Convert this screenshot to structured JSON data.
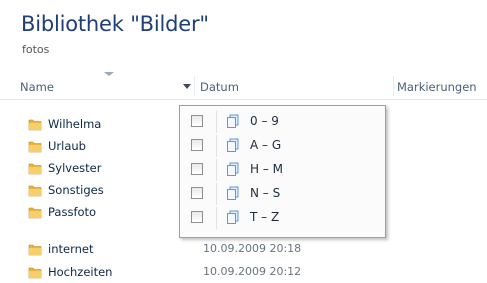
{
  "library": {
    "title": "Bibliothek \"Bilder\"",
    "subtitle": "fotos"
  },
  "columns": {
    "name": "Name",
    "datum": "Datum",
    "markierungen": "Markierungen"
  },
  "folders": [
    {
      "name": "Wilhelma",
      "date": ""
    },
    {
      "name": "Urlaub",
      "date": ""
    },
    {
      "name": "Sylvester",
      "date": ""
    },
    {
      "name": "Sonstiges",
      "date": ""
    },
    {
      "name": "Passfoto",
      "date": ""
    },
    {
      "name": "internet",
      "date": "10.09.2009 20:18"
    },
    {
      "name": "Hochzeiten",
      "date": "10.09.2009 20:12"
    }
  ],
  "filter_popup": {
    "items": [
      {
        "label": "0 – 9",
        "checked": false
      },
      {
        "label": "A – G",
        "checked": false
      },
      {
        "label": "H – M",
        "checked": false
      },
      {
        "label": "N – S",
        "checked": false
      },
      {
        "label": "T – Z",
        "checked": false
      }
    ]
  },
  "colors": {
    "title": "#1e3e78",
    "folder": "#e8b43c",
    "popup_border": "#a0a0a0"
  }
}
